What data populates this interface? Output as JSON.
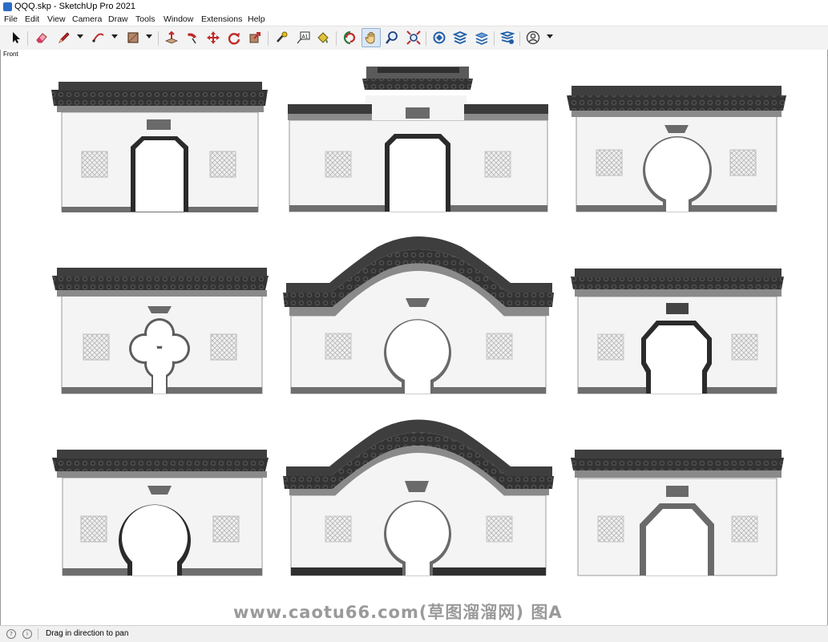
{
  "window": {
    "title": "QQQ.skp - SketchUp Pro 2021"
  },
  "menu": [
    "File",
    "Edit",
    "View",
    "Camera",
    "Draw",
    "Tools",
    "Window",
    "Extensions",
    "Help"
  ],
  "toolbar": {
    "tools": [
      "select-tool",
      "eraser-tool",
      "pencil-line-tool",
      "arc-tool",
      "rectangle-tool",
      "push-pull-tool",
      "follow-me-tool",
      "move-tool",
      "rotate-tool",
      "scale-tool",
      "tape-measure-tool",
      "text-tool",
      "paint-bucket-tool",
      "orbit-tool",
      "pan-tool",
      "zoom-tool",
      "zoom-extents-tool",
      "warehouse-tool",
      "extension-warehouse-tool",
      "layout-tool",
      "extension-manager-tool",
      "account-tool"
    ],
    "active_tool": "pan-tool"
  },
  "viewport": {
    "scene_label": "Front"
  },
  "watermark": "www.caotu66.com(草图溜溜网) 图A",
  "status": {
    "hint": "Drag in direction to pan"
  },
  "colors": {
    "roof": "#3e3e3e",
    "wall": "#f4f4f4",
    "plinth": "#6e6e6e",
    "accent": "#2b6cc4"
  }
}
